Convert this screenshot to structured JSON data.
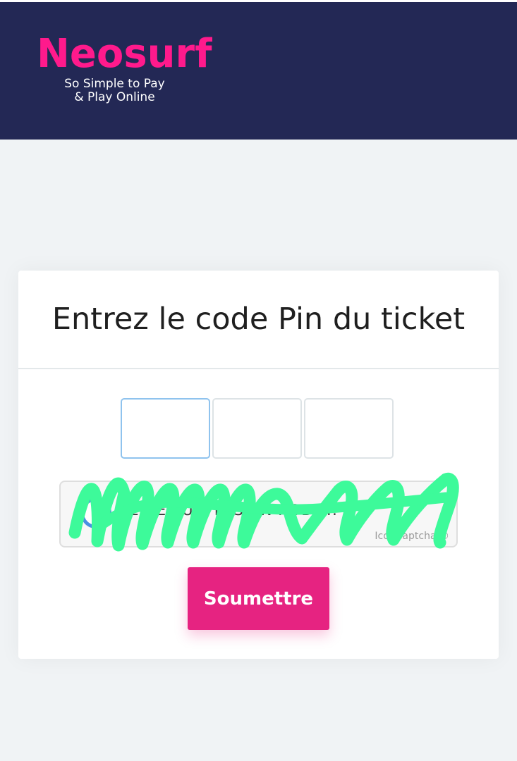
{
  "header": {
    "brand": "Neosurf",
    "tagline_line1": "So Simple to Pay",
    "tagline_line2": "& Play Online"
  },
  "card": {
    "title": "Entrez le code Pin du ticket",
    "pin_fields": [
      {
        "value": "",
        "focused": true
      },
      {
        "value": "",
        "focused": false
      },
      {
        "value": "",
        "focused": false
      }
    ],
    "captcha": {
      "label": "JE NE SUIS PAS UN ROBOT.",
      "brand": "IconCaptcha ©",
      "obscured_by_scribble": true
    },
    "submit_label": "Soumettre"
  },
  "colors": {
    "header_bg": "#232855",
    "brand_pink": "#ff1a8c",
    "submit_bg": "#e62381",
    "page_bg": "#f0f3f5",
    "scribble": "#3dfa9a"
  }
}
